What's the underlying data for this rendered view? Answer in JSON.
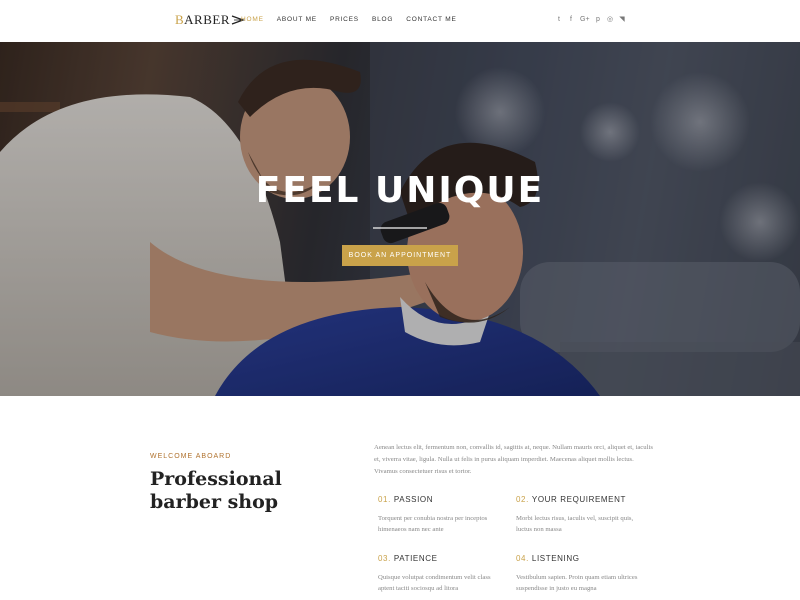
{
  "header": {
    "logo_first_letter": "B",
    "logo_rest": "ARBER",
    "nav": [
      {
        "label": "HOME",
        "active": true
      },
      {
        "label": "ABOUT ME",
        "active": false
      },
      {
        "label": "PRICES",
        "active": false
      },
      {
        "label": "BLOG",
        "active": false
      },
      {
        "label": "CONTACT ME",
        "active": false
      }
    ],
    "social": [
      {
        "icon": "twitter-icon",
        "glyph": "t"
      },
      {
        "icon": "facebook-icon",
        "glyph": "f"
      },
      {
        "icon": "google-plus-icon",
        "glyph": "G+"
      },
      {
        "icon": "pinterest-icon",
        "glyph": "p"
      },
      {
        "icon": "instagram-icon",
        "glyph": "◎"
      },
      {
        "icon": "rss-icon",
        "glyph": "◥"
      }
    ]
  },
  "hero": {
    "title": "FEEL UNIQUE",
    "button_label": "BOOK AN APPOINTMENT"
  },
  "welcome": {
    "eyebrow": "WELCOME ABOARD",
    "headline": "Professional barber shop",
    "intro": "Aenean lectus elit, fermentum non, convallis id, sagittis at, neque. Nullam mauris orci, aliquet et, iaculis et, viverra vitae, ligula. Nulla ut felis in purus aliquam imperdiet. Maecenas aliquet mollis lectus. Vivamus consectetuer risus et tortor.",
    "features": [
      {
        "num": "01.",
        "title": "PASSION",
        "text": "Torquent per conubia nostra per inceptos himenaeos nam nec ante"
      },
      {
        "num": "02.",
        "title": "YOUR REQUIREMENT",
        "text": "Morbi lectus risus, iaculis vel, suscipit quis, luctus non massa"
      },
      {
        "num": "03.",
        "title": "PATIENCE",
        "text": "Quisque volutpat condimentum velit class aptent taciti sociosqu ad litora"
      },
      {
        "num": "04.",
        "title": "LISTENING",
        "text": "Vestibulum sapien. Proin quam etiam ultrices suspendisse in justo eu magna"
      }
    ]
  },
  "colors": {
    "accent": "#c9a24a",
    "eyebrow": "#b0722e"
  }
}
